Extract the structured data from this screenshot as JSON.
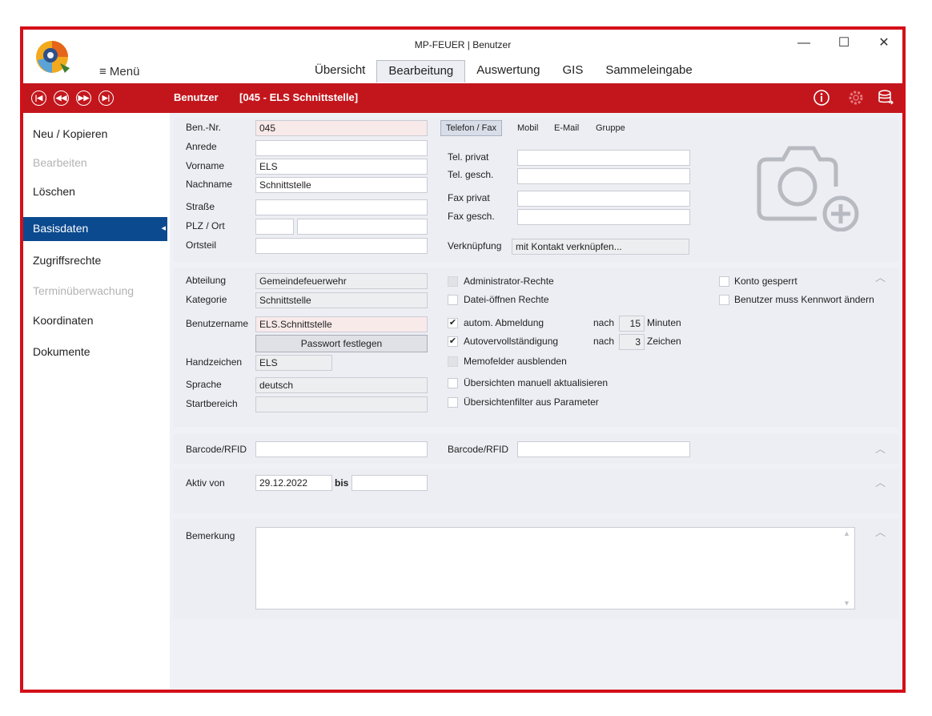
{
  "window": {
    "title": "MP-FEUER | Benutzer",
    "minimize": "—",
    "maximize": "☐",
    "close": "✕"
  },
  "menu": {
    "label": "≡ Menü"
  },
  "tabs": [
    {
      "label": "Übersicht"
    },
    {
      "label": "Bearbeitung"
    },
    {
      "label": "Auswertung"
    },
    {
      "label": "GIS"
    },
    {
      "label": "Sammeleingabe"
    }
  ],
  "record": {
    "entity": "Benutzer",
    "title": "[045 - ELS Schnittstelle]"
  },
  "navigation": [
    "first-record-icon",
    "previous-record-icon",
    "next-record-icon",
    "last-record-icon"
  ],
  "sidebar": {
    "actions": [
      {
        "label": "Neu / Kopieren",
        "enabled": true
      },
      {
        "label": "Bearbeiten",
        "enabled": false
      },
      {
        "label": "Löschen",
        "enabled": true
      }
    ],
    "sections": [
      {
        "label": "Basisdaten",
        "active": true,
        "enabled": true
      },
      {
        "label": "Zugriffsrechte",
        "enabled": true
      },
      {
        "label": "Terminüberwachung",
        "enabled": false
      },
      {
        "label": "Koordinaten",
        "enabled": true
      },
      {
        "label": "Dokumente",
        "enabled": true
      }
    ],
    "active_marker": "◂"
  },
  "person": {
    "ben_nr": {
      "label": "Ben.-Nr.",
      "value": "045"
    },
    "anrede": {
      "label": "Anrede",
      "value": ""
    },
    "vorname": {
      "label": "Vorname",
      "value": "ELS"
    },
    "nachname": {
      "label": "Nachname",
      "value": "Schnittstelle"
    },
    "strasse": {
      "label": "Straße",
      "value": ""
    },
    "plz_ort": {
      "label": "PLZ / Ort",
      "plz": "",
      "ort": ""
    },
    "ortsteil": {
      "label": "Ortsteil",
      "value": ""
    }
  },
  "contact_tabs": [
    {
      "label": "Telefon / Fax",
      "active": true
    },
    {
      "label": "Mobil"
    },
    {
      "label": "E-Mail"
    },
    {
      "label": "Gruppe"
    }
  ],
  "phone": {
    "tel_privat": {
      "label": "Tel. privat",
      "value": ""
    },
    "tel_gesch": {
      "label": "Tel. gesch.",
      "value": ""
    },
    "fax_privat": {
      "label": "Fax privat",
      "value": ""
    },
    "fax_gesch": {
      "label": "Fax gesch.",
      "value": ""
    }
  },
  "verknuepfung": {
    "label": "Verknüpfung",
    "value": "mit Kontakt verknüpfen..."
  },
  "account": {
    "abteilung": {
      "label": "Abteilung",
      "value": "Gemeindefeuerwehr"
    },
    "kategorie": {
      "label": "Kategorie",
      "value": "Schnittstelle"
    },
    "benutzername": {
      "label": "Benutzername",
      "value": "ELS.Schnittstelle"
    },
    "passwort_button": "Passwort festlegen",
    "handzeichen": {
      "label": "Handzeichen",
      "value": "ELS"
    },
    "sprache": {
      "label": "Sprache",
      "value": "deutsch"
    },
    "startbereich": {
      "label": "Startbereich",
      "value": ""
    }
  },
  "options": {
    "admin": {
      "label": "Administrator-Rechte",
      "checked": false,
      "enabled": false
    },
    "datei": {
      "label": "Datei-öffnen Rechte",
      "checked": false
    },
    "abmeldung": {
      "label": "autom. Abmeldung",
      "checked": true,
      "after": "nach",
      "value": "15",
      "unit": "Minuten"
    },
    "autovervollstaendigung": {
      "label": "Autovervollständigung",
      "checked": true,
      "after": "nach",
      "value": "3",
      "unit": "Zeichen"
    },
    "memofelder": {
      "label": "Memofelder ausblenden",
      "checked": false,
      "enabled": false
    },
    "uebersichten": {
      "label": "Übersichten manuell aktualisieren",
      "checked": false
    },
    "filter": {
      "label": "Übersichtenfilter aus Parameter",
      "checked": false
    },
    "konto_gesperrt": {
      "label": "Konto gesperrt",
      "checked": false
    },
    "kennwort_aendern": {
      "label": "Benutzer muss Kennwort ändern",
      "checked": false
    }
  },
  "barcode": {
    "label1": "Barcode/RFID",
    "value1": "",
    "label2": "Barcode/RFID",
    "value2": ""
  },
  "aktiv": {
    "label": "Aktiv von",
    "from": "29.12.2022",
    "bis_label": "bis",
    "to": ""
  },
  "bemerkung": {
    "label": "Bemerkung",
    "value": ""
  },
  "check_mark": "✔",
  "collapse_glyph": "︿",
  "scroll_up": "▲",
  "scroll_down": "▼",
  "colors": {
    "accent_red": "#c3161c",
    "sidebar_active": "#0b4a8f",
    "panel_bg": "#eceef3"
  }
}
